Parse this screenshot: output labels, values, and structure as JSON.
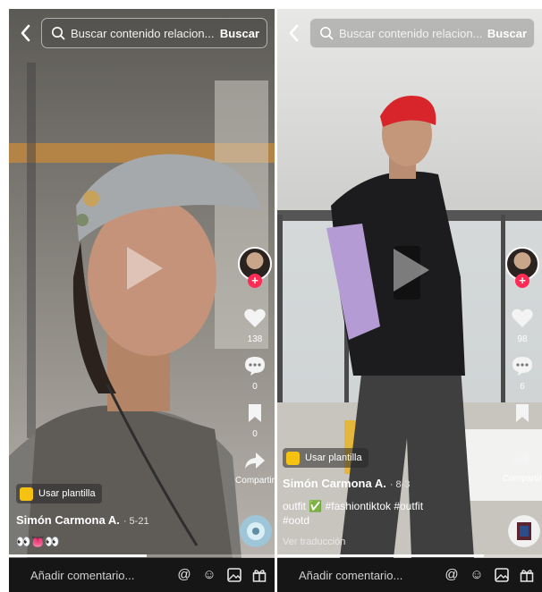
{
  "panels": [
    {
      "search": {
        "placeholder": "Buscar contenido relacion...",
        "button": "Buscar"
      },
      "rail": {
        "likes": "138",
        "comments": "0",
        "saves": "0",
        "share": "Compartir"
      },
      "template": "Usar plantilla",
      "author": "Simón Carmona A.",
      "date": "· 5-21",
      "caption": "👀👅👀",
      "progress": 0.52,
      "comment_placeholder": "Añadir comentario..."
    },
    {
      "search": {
        "placeholder": "Buscar contenido relacion...",
        "button": "Buscar"
      },
      "rail": {
        "likes": "98",
        "comments": "6",
        "share": "Compartir"
      },
      "template": "Usar plantilla",
      "author": "Simón Carmona A.",
      "date": "· 8-3",
      "caption_line1": "outfit ✅ #fashiontiktok #outfit",
      "caption_line2": "#ootd",
      "translate": "Ver traducción",
      "progress": 0.78,
      "comment_placeholder": "Añadir comentario..."
    }
  ],
  "colors": {
    "accent": "#fe2c55",
    "template_badge": "#f5c211",
    "bar": "#161616"
  },
  "icons": [
    "back-arrow-icon",
    "search-icon",
    "play-icon",
    "heart-icon",
    "comment-icon",
    "bookmark-icon",
    "share-icon",
    "at-icon",
    "emoji-icon",
    "image-icon",
    "gift-icon",
    "music-disc-icon"
  ]
}
